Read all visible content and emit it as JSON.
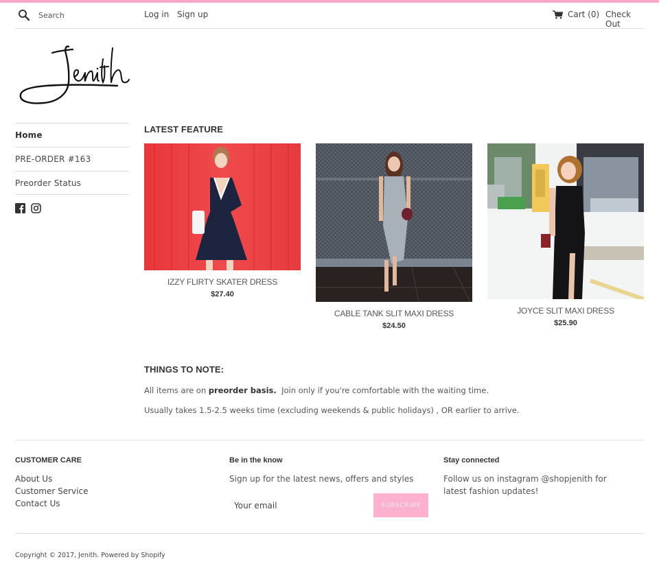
{
  "header": {
    "search_placeholder": "Search",
    "login_label": "Log in",
    "signup_label": "Sign up",
    "cart_label": "Cart (0)",
    "checkout_label": "Check Out",
    "accent_color": "#f7a8c8"
  },
  "logo": {
    "text": "Jenith"
  },
  "sidebar": {
    "items": [
      {
        "label": "Home",
        "active": true
      },
      {
        "label": "PRE-ORDER #163"
      },
      {
        "label": "Preorder Status"
      }
    ],
    "social": [
      "facebook-icon",
      "instagram-icon"
    ]
  },
  "main": {
    "latest_title": "LATEST FEATURE",
    "products": [
      {
        "name": "IZZY FLIRTY SKATER DRESS",
        "price": "$27.40"
      },
      {
        "name": "CABLE TANK SLIT MAXI DRESS",
        "price": "$24.50"
      },
      {
        "name": "JOYCE SLIT MAXI DRESS",
        "price": "$25.90"
      }
    ],
    "notes_title": "THINGS TO NOTE:",
    "note1_prefix": "All items are on ",
    "note1_bold": "preorder basis.",
    "note1_suffix": "  Join only if you're comfortable with the waiting time.",
    "note2": "Usually takes 1.5-2.5 weeks time (excluding weekends & public holidays) , OR earlier to arrive."
  },
  "footer": {
    "customer_care": {
      "title": "CUSTOMER CARE",
      "links": [
        "About Us",
        "Customer Service",
        "Contact Us"
      ]
    },
    "newsletter": {
      "title": "Be in the know",
      "text": "Sign up for the latest news, offers and styles",
      "email_placeholder": "Your email",
      "subscribe_label": "SUBSCRIBE",
      "button_color": "#fdb1cf"
    },
    "stay_connected": {
      "title": "Stay connected",
      "text": "Follow us on instagram @shopjenith for latest fashion updates!"
    },
    "copyright": "Copyright © 2017, Jenith. Powered by Shopify"
  }
}
